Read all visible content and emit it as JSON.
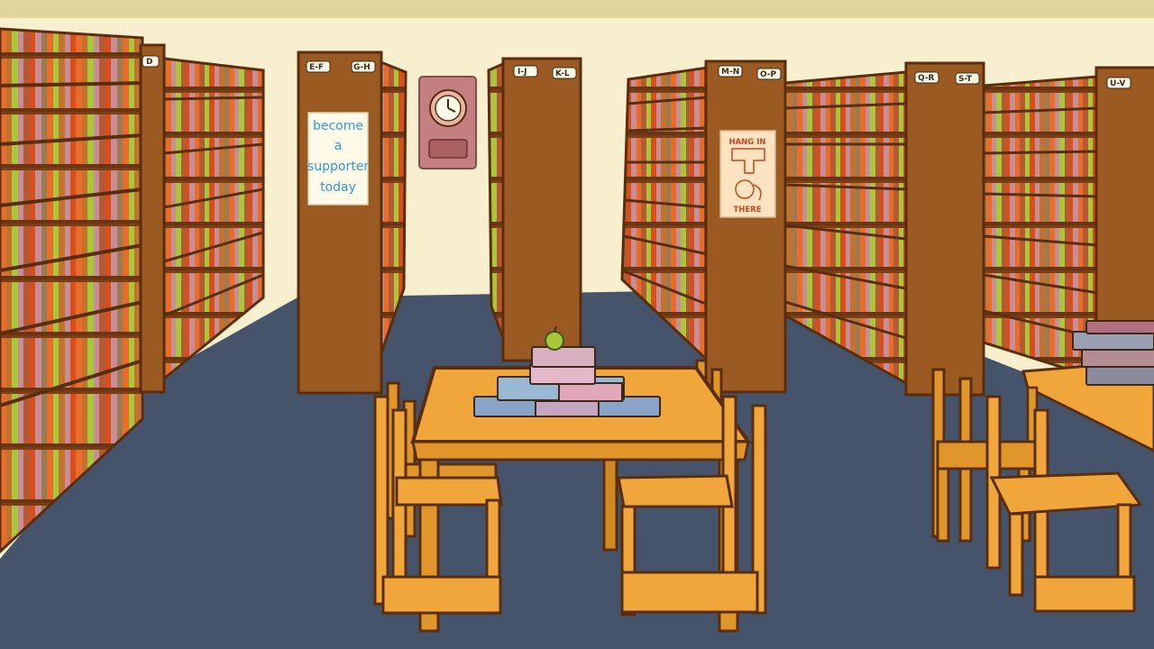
{
  "scene": {
    "name": "library-stacks"
  },
  "shelf_labels": [
    "D",
    "E-F",
    "G-H",
    "I-J",
    "K-L",
    "M-N",
    "O-P",
    "Q-R",
    "S-T",
    "U-V"
  ],
  "posters": {
    "supporter": [
      "become",
      "a",
      "supporter",
      "today"
    ],
    "hang_in": {
      "top": "HANG IN",
      "bottom": "THERE"
    }
  },
  "colors": {
    "wall": "#f7efcd",
    "floor": "#46546b",
    "wood": "#9a5a22",
    "table": "#f0a63a",
    "book_palette": [
      "#e86d2b",
      "#c4732f",
      "#a8c83a",
      "#c88e98",
      "#b55a34",
      "#d94f1c",
      "#9c7a52"
    ]
  }
}
